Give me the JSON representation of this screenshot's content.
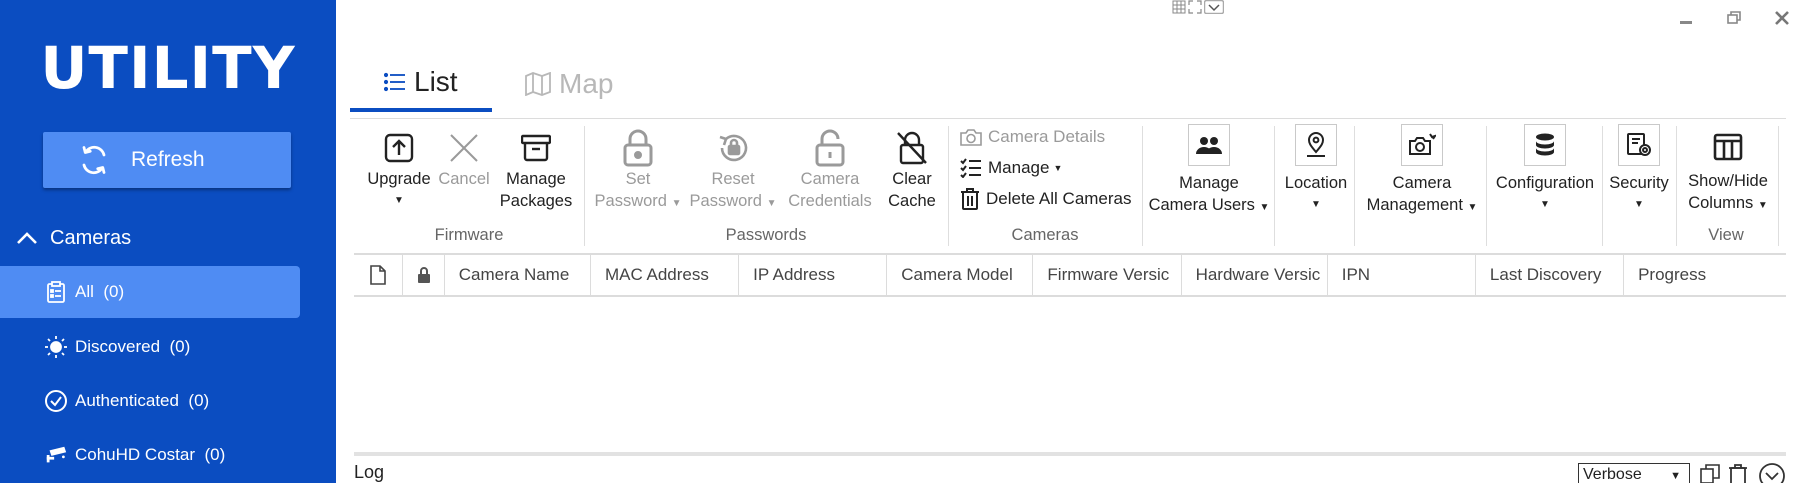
{
  "sidebar": {
    "title": "UTILITY",
    "refresh_label": "Refresh",
    "section_label": "Cameras",
    "items": [
      {
        "label": "All",
        "count": "(0)",
        "icon": "clipboard-list-icon"
      },
      {
        "label": "Discovered",
        "count": "(0)",
        "icon": "sun-icon"
      },
      {
        "label": "Authenticated",
        "count": "(0)",
        "icon": "check-circle-icon"
      },
      {
        "label": "CohuHD Costar",
        "count": "(0)",
        "icon": "security-camera-icon"
      }
    ]
  },
  "tabs": [
    {
      "label": "List",
      "icon": "list-icon",
      "active": true
    },
    {
      "label": "Map",
      "icon": "map-icon",
      "active": false
    }
  ],
  "ribbon": {
    "groups": {
      "firmware": "Firmware",
      "passwords": "Passwords",
      "cameras": "Cameras",
      "view": "View"
    },
    "upgrade": "Upgrade",
    "cancel": "Cancel",
    "manage_packages_1": "Manage",
    "manage_packages_2": "Packages",
    "set_password_1": "Set",
    "set_password_2": "Password",
    "reset_password_1": "Reset",
    "reset_password_2": "Password",
    "camera_credentials_1": "Camera",
    "camera_credentials_2": "Credentials",
    "clear_cache_1": "Clear",
    "clear_cache_2": "Cache",
    "camera_details": "Camera Details",
    "manage": "Manage",
    "delete_all": "Delete All Cameras",
    "manage_users_1": "Manage",
    "manage_users_2": "Camera Users",
    "location": "Location",
    "camera_mgmt_1": "Camera",
    "camera_mgmt_2": "Management",
    "configuration": "Configuration",
    "security": "Security",
    "show_hide_1": "Show/Hide",
    "show_hide_2": "Columns"
  },
  "table": {
    "columns": [
      "Camera Name",
      "MAC Address",
      "IP Address",
      "Camera Model",
      "Firmware Versic",
      "Hardware Versic",
      "IPN",
      "Last Discovery",
      "Progress"
    ]
  },
  "log": {
    "label": "Log",
    "level": "Verbose"
  },
  "colors": {
    "sidebar": "#0b4dc1",
    "accent": "#4f8cf3"
  }
}
